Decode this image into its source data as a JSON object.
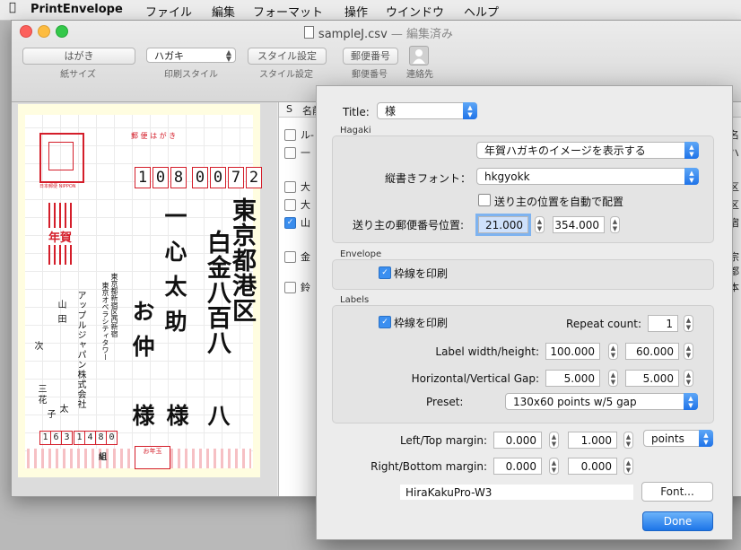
{
  "menubar": {
    "apple": "",
    "app": "PrintEnvelope",
    "items": [
      "ファイル",
      "編集",
      "フォーマット",
      "操作",
      "ウインドウ",
      "ヘルプ"
    ]
  },
  "window": {
    "title": "sampleJ.csv",
    "subtitle": "— 編集済み"
  },
  "toolbar": {
    "paper_size_value": "はがき",
    "paper_size_label": "紙サイズ",
    "print_style_value": "ハガキ",
    "print_style_label": "印刷スタイル",
    "style_settings_button": "スタイル設定",
    "style_settings_label": "スタイル設定",
    "postal_code_button": "郵便番号",
    "postal_code_label": "郵便番号",
    "contacts_label": "連絡先"
  },
  "postcard": {
    "header": "郵 便 は が き",
    "nippon": "日本郵便 NIPPON",
    "zip": [
      "1",
      "0",
      "8",
      "0",
      "0",
      "7",
      "2"
    ],
    "address_line1": "東京都港区",
    "address_line2": "白金八百八",
    "address_line3": "八",
    "recipient_col1": "一心太助",
    "recipient_col2": "お仲",
    "honorific1": "様",
    "honorific2": "様",
    "new_year": "年賀",
    "sender_company": "アップルジャパン株式会社",
    "sender_tower": "東京オペラシティタワー",
    "sender_address": "東京都新宿区西新宿",
    "sender_names_1": "山田",
    "sender_names_2": "太",
    "sender_names_3": "次",
    "sender_names_4": "三花",
    "sender_names_5": "子",
    "sender_zip": [
      "1",
      "6",
      "3",
      "1",
      "4",
      "8",
      "0"
    ],
    "lottery": "組",
    "otoshidama": "お年玉"
  },
  "list": {
    "header_s": "S",
    "header_name": "名前",
    "rows": [
      {
        "checked": false,
        "name": "ル-",
        "right": "名"
      },
      {
        "checked": false,
        "name": "一",
        "right": "ハ"
      },
      {
        "checked": false,
        "name": "大",
        "right": "区"
      },
      {
        "checked": false,
        "name": "大",
        "right": "区"
      },
      {
        "checked": true,
        "name": "山",
        "right": "宿"
      },
      {
        "checked": false,
        "name": "金",
        "right": "宗都"
      },
      {
        "checked": false,
        "name": "鈴",
        "right": "本"
      }
    ]
  },
  "dialog": {
    "title_label": "Title:",
    "title_value": "様",
    "hagaki_section": "Hagaki",
    "hagaki_image_popup": "年賀ハガキのイメージを表示する",
    "vertical_font_label": "縦書きフォント：",
    "vertical_font_value": "hkgyokk",
    "auto_sender_checkbox": "送り主の位置を自動で配置",
    "sender_zip_pos_label": "送り主の郵便番号位置:",
    "sender_zip_x": "21.000",
    "sender_zip_y": "354.000",
    "envelope_section": "Envelope",
    "envelope_print_border": "枠線を印刷",
    "labels_section": "Labels",
    "labels_print_border": "枠線を印刷",
    "repeat_count_label": "Repeat count:",
    "repeat_count_value": "1",
    "label_wh_label": "Label width/height:",
    "label_width": "100.000",
    "label_height": "60.000",
    "gap_label": "Horizontal/Vertical Gap:",
    "gap_h": "5.000",
    "gap_v": "5.000",
    "preset_label": "Preset:",
    "preset_value": "130x60 points w/5 gap",
    "left_top_label": "Left/Top margin:",
    "left_margin": "0.000",
    "top_margin": "1.000",
    "unit_value": "points",
    "right_bottom_label": "Right/Bottom margin:",
    "right_margin": "0.000",
    "bottom_margin": "0.000",
    "font_name": "HiraKakuPro-W3",
    "font_button": "Font...",
    "done_button": "Done"
  },
  "colors": {
    "accent": "#1d75e8",
    "postal_red": "#d41e2a",
    "card_border": "#fffde0"
  }
}
